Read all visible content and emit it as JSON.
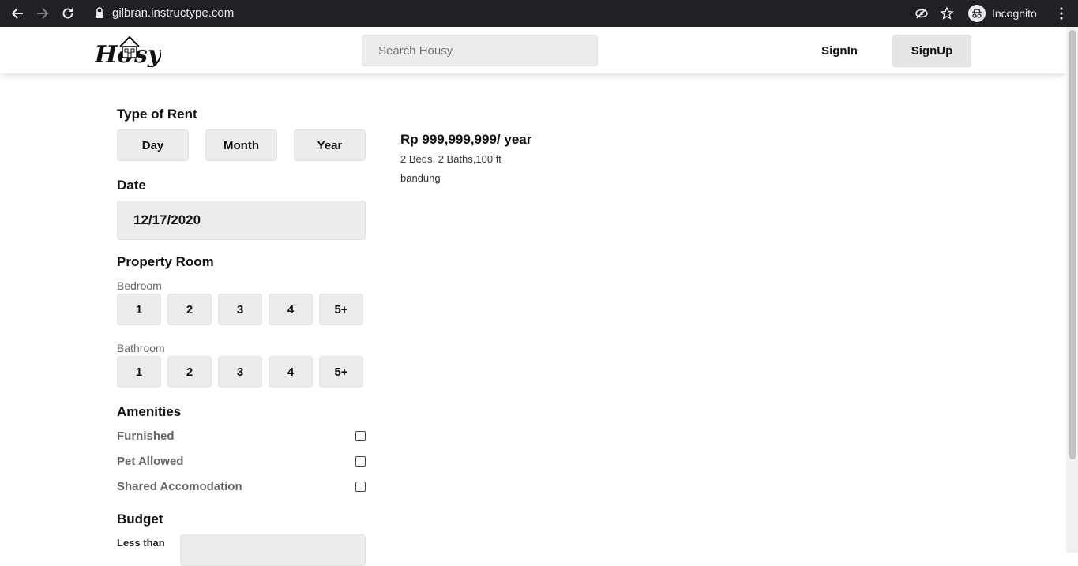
{
  "browser": {
    "url": "gilbran.instructype.com",
    "profile_label": "Incognito",
    "icons": [
      "back-icon",
      "forward-icon",
      "reload-icon",
      "lock-icon",
      "eye-off-icon",
      "star-icon",
      "incognito-icon",
      "menu-dots-icon"
    ]
  },
  "header": {
    "logo_text": "Housy",
    "search_placeholder": "Search Housy",
    "signin_label": "SignIn",
    "signup_label": "SignUp"
  },
  "filters": {
    "type_of_rent": {
      "title": "Type of Rent",
      "options": [
        "Day",
        "Month",
        "Year"
      ]
    },
    "date": {
      "title": "Date",
      "value": "12/17/2020"
    },
    "property_room": {
      "title": "Property Room",
      "bedroom_label": "Bedroom",
      "bedroom_options": [
        "1",
        "2",
        "3",
        "4",
        "5+"
      ],
      "bathroom_label": "Bathroom",
      "bathroom_options": [
        "1",
        "2",
        "3",
        "4",
        "5+"
      ]
    },
    "amenities": {
      "title": "Amenities",
      "items": [
        "Furnished",
        "Pet Allowed",
        "Shared Accomodation"
      ]
    },
    "budget": {
      "title": "Budget",
      "less_than_label": "Less than"
    }
  },
  "listing": {
    "price": "Rp 999,999,999/ year",
    "specs": "2 Beds, 2 Baths,100 ft",
    "location": "bandung"
  },
  "colors": {
    "chrome_bg": "#202124",
    "pill_bg": "#ececec",
    "text": "#111111",
    "muted": "#666666"
  }
}
